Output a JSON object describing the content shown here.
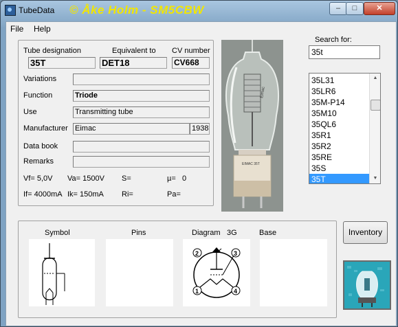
{
  "window": {
    "title": "TubeData",
    "credit": "© Åke Holm - SM5CBW",
    "min_glyph": "–",
    "max_glyph": "□",
    "close_glyph": "✕"
  },
  "menu": [
    {
      "label": "File"
    },
    {
      "label": "Help"
    }
  ],
  "tube": {
    "designation_label": "Tube designation",
    "designation": "35T",
    "equivalent_label": "Equivalent to",
    "equivalent": "DET18",
    "cv_label": "CV number",
    "cv": "CV668",
    "variations_label": "Variations",
    "variations": "",
    "function_label": "Function",
    "function": "Triode",
    "use_label": "Use",
    "use": "Transmitting tube",
    "manufacturer_label": "Manufacturer",
    "manufacturer": "Eimac",
    "year": "1938",
    "databook_label": "Data book",
    "databook": "",
    "remarks_label": "Remarks",
    "remarks": ""
  },
  "params": {
    "vf": "Vf= 5,0V",
    "va": "Va= 1500V",
    "s": "S=",
    "mu": "µ=",
    "mu_value": "0",
    "if": "If= 4000mA",
    "ik": "Ik= 150mA",
    "ri": "Ri=",
    "pa": "Pa="
  },
  "search": {
    "label": "Search for:",
    "value": "35t"
  },
  "tube_list": {
    "items": [
      "35L31",
      "35LR6",
      "35M-P14",
      "35M10",
      "35QL6",
      "35R1",
      "35R2",
      "35RE",
      "35S",
      "35T"
    ],
    "selected": "35T"
  },
  "diagram_panel": {
    "symbol_label": "Symbol",
    "pins_label": "Pins",
    "diagram_label": "Diagram",
    "diagram_code": "3G",
    "base_label": "Base",
    "pin_numbers": [
      "1",
      "2",
      "3",
      "4"
    ]
  },
  "photo": {
    "glass_text": "Eimac",
    "base_text": "EIMAC 35T"
  },
  "buttons": {
    "inventory": "Inventory"
  },
  "colors": {
    "title_credit": "#f2e600",
    "selection": "#3399ff",
    "logo": "#2aa6b9"
  }
}
